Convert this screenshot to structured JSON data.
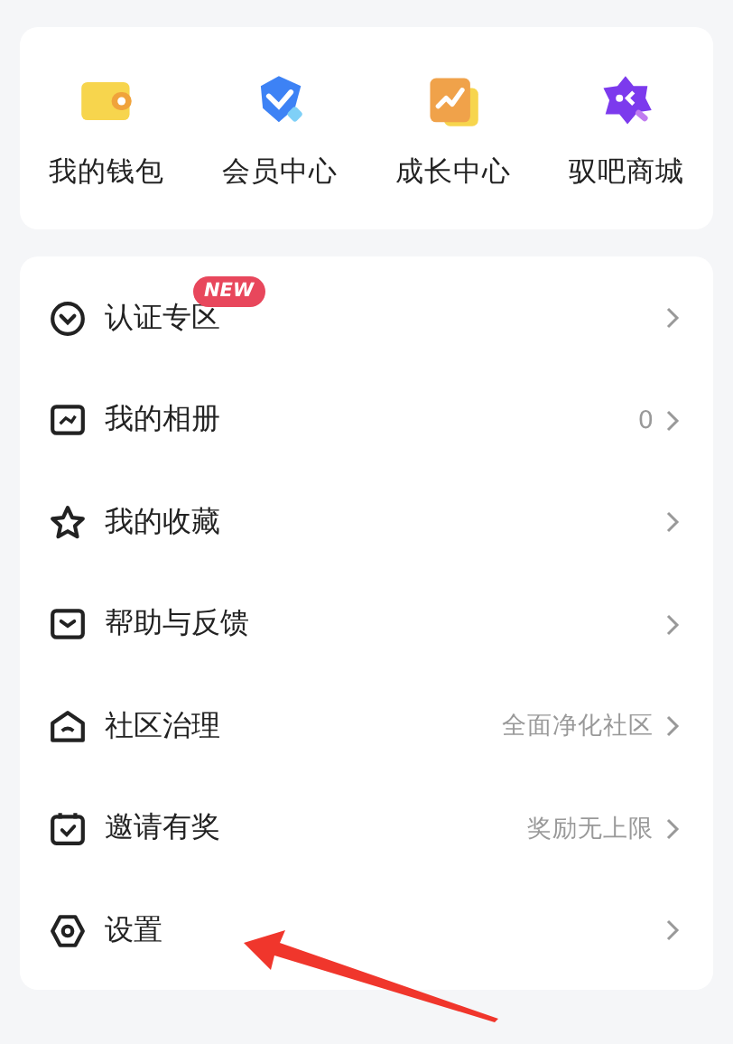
{
  "shortcuts": [
    {
      "label": "我的钱包"
    },
    {
      "label": "会员中心"
    },
    {
      "label": "成长中心"
    },
    {
      "label": "驭吧商城"
    }
  ],
  "menu": [
    {
      "label": "认证专区",
      "badge": "NEW"
    },
    {
      "label": "我的相册",
      "detail": "0"
    },
    {
      "label": "我的收藏"
    },
    {
      "label": "帮助与反馈"
    },
    {
      "label": "社区治理",
      "detail": "全面净化社区"
    },
    {
      "label": "邀请有奖",
      "detail": "奖励无上限"
    },
    {
      "label": "设置"
    }
  ]
}
